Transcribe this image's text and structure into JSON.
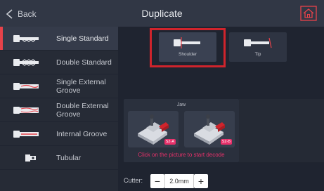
{
  "header": {
    "back_label": "Back",
    "title": "Duplicate"
  },
  "sidebar": {
    "items": [
      {
        "label": "Single Standard",
        "active": true
      },
      {
        "label": "Double Standard",
        "active": false
      },
      {
        "label": "Single External Groove",
        "active": false
      },
      {
        "label": "Double External Groove",
        "active": false
      },
      {
        "label": "Internal Groove",
        "active": false
      },
      {
        "label": "Tubular",
        "active": false
      }
    ]
  },
  "positioning": {
    "options": [
      {
        "label": "Shoulder",
        "selected": true
      },
      {
        "label": "Tip",
        "selected": false
      }
    ]
  },
  "jaw": {
    "title": "Jaw",
    "options": [
      {
        "badge": "S2-A"
      },
      {
        "badge": "S2-B"
      }
    ],
    "hint": "Click on the picture to start decode"
  },
  "cutter": {
    "label": "Cutter:",
    "value": "2.0mm",
    "minus": "−",
    "plus": "+"
  },
  "colors": {
    "accent": "#e8424a",
    "highlight": "#d0242c",
    "hint": "#e8306a",
    "background": "#1f2430"
  }
}
